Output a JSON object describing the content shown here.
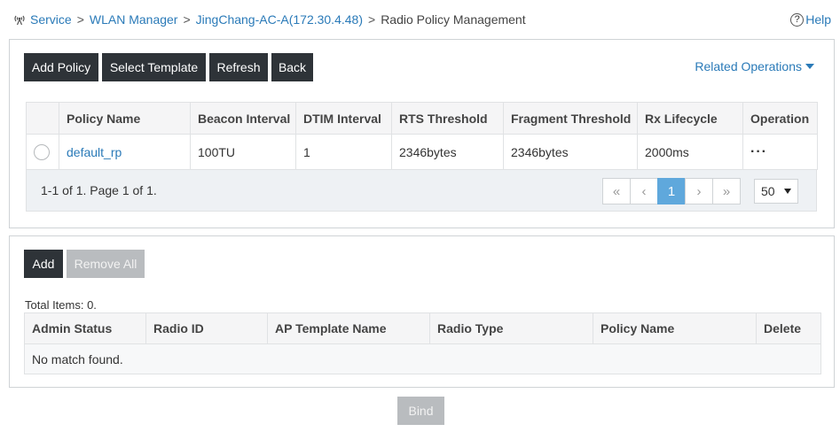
{
  "breadcrumb": {
    "items": [
      "Service",
      "WLAN Manager",
      "JingChang-AC-A(172.30.4.48)"
    ],
    "current": "Radio Policy Management",
    "separator": ">"
  },
  "help": {
    "label": "Help",
    "icon": "?"
  },
  "toolbar": {
    "add_policy": "Add Policy",
    "select_template": "Select Template",
    "refresh": "Refresh",
    "back": "Back"
  },
  "related_operations": "Related Operations",
  "policy_table": {
    "columns": [
      "Policy Name",
      "Beacon Interval",
      "DTIM Interval",
      "RTS Threshold",
      "Fragment Threshold",
      "Rx Lifecycle",
      "Operation"
    ],
    "rows": [
      {
        "policy_name": "default_rp",
        "beacon_interval": "100TU",
        "dtim_interval": "1",
        "rts_threshold": "2346bytes",
        "fragment_threshold": "2346bytes",
        "rx_lifecycle": "2000ms",
        "operation": "···"
      }
    ]
  },
  "pagination": {
    "summary": "1-1 of 1. Page 1 of 1.",
    "first": "«",
    "prev": "‹",
    "current_page": "1",
    "next": "›",
    "last": "»",
    "page_size": "50"
  },
  "binding": {
    "add": "Add",
    "remove_all": "Remove All",
    "total": "Total Items: 0.",
    "columns": [
      "Admin Status",
      "Radio ID",
      "AP Template Name",
      "Radio Type",
      "Policy Name",
      "Delete"
    ],
    "empty_message": "No match found."
  },
  "bind_button": "Bind",
  "colors": {
    "link": "#2a7ab8",
    "dark_button": "#2e3338",
    "disabled_button": "#b9bcbf",
    "active_page": "#5fa8dc"
  }
}
